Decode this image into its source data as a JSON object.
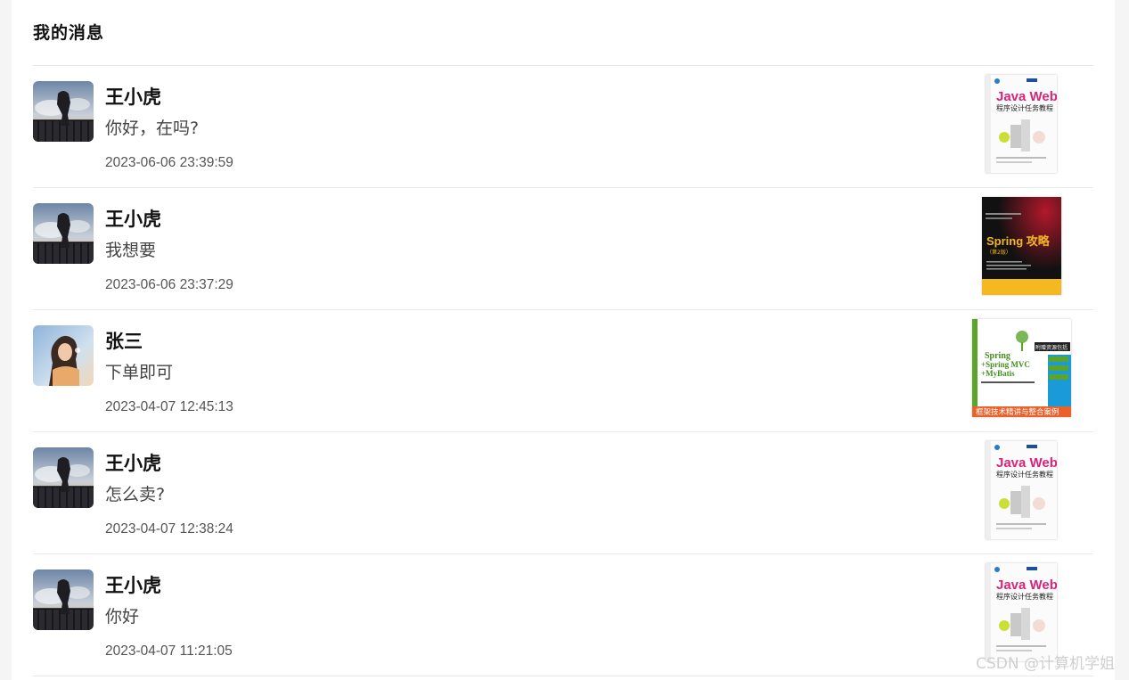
{
  "page": {
    "title": "我的消息"
  },
  "messages": [
    {
      "name": "王小虎",
      "text": "你好，在吗?",
      "time": "2023-06-06 23:39:59",
      "avatar_icon": "anime-boy-avatar",
      "book": "java-web-book",
      "book_text": {
        "title1": "Java Web",
        "title2": "程序设计任务教程"
      }
    },
    {
      "name": "王小虎",
      "text": "我想要",
      "time": "2023-06-06 23:37:29",
      "avatar_icon": "anime-boy-avatar",
      "book": "spring-book",
      "book_text": {
        "title1": "Spring 攻略",
        "title2": "（第2版）"
      }
    },
    {
      "name": "张三",
      "text": "下单即可",
      "time": "2023-04-07 12:45:13",
      "avatar_icon": "girl-photo-avatar",
      "book": "ssm-book",
      "book_text": {
        "title1": "Spring",
        "title2": "+Spring MVC",
        "title3": "+MyBatis",
        "banner": "框架技术精讲与整合案例",
        "tag": "附赠资源包括"
      }
    },
    {
      "name": "王小虎",
      "text": "怎么卖?",
      "time": "2023-04-07 12:38:24",
      "avatar_icon": "anime-boy-avatar",
      "book": "java-web-book",
      "book_text": {
        "title1": "Java Web",
        "title2": "程序设计任务教程"
      }
    },
    {
      "name": "王小虎",
      "text": "你好",
      "time": "2023-04-07 11:21:05",
      "avatar_icon": "anime-boy-avatar",
      "book": "java-web-book",
      "book_text": {
        "title1": "Java Web",
        "title2": "程序设计任务教程"
      }
    }
  ],
  "watermark": "CSDN @计算机学姐",
  "colors": {
    "accent_pink": "#d8247a",
    "spring_yellow": "#f4b820",
    "ssm_orange": "#e8622a",
    "ssm_green": "#5aa52a"
  }
}
